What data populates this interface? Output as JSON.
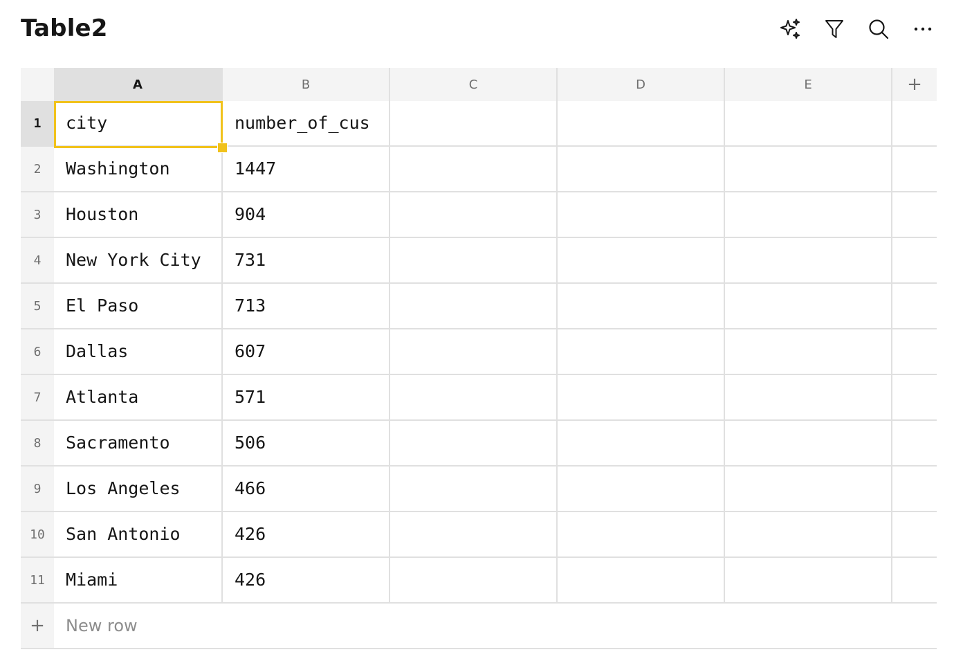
{
  "title": "Table2",
  "toolbar": {
    "icons": [
      "sparkle-icon",
      "filter-icon",
      "search-icon",
      "more-icon"
    ]
  },
  "columns": [
    "A",
    "B",
    "C",
    "D",
    "E"
  ],
  "add_column_label": "+",
  "selected": {
    "row": 1,
    "column": "A"
  },
  "rows": [
    {
      "num": "1",
      "cells": [
        "city",
        "number_of_cus",
        "",
        "",
        ""
      ]
    },
    {
      "num": "2",
      "cells": [
        "Washington",
        "1447",
        "",
        "",
        ""
      ]
    },
    {
      "num": "3",
      "cells": [
        "Houston",
        "904",
        "",
        "",
        ""
      ]
    },
    {
      "num": "4",
      "cells": [
        "New York City",
        "731",
        "",
        "",
        ""
      ]
    },
    {
      "num": "5",
      "cells": [
        "El Paso",
        "713",
        "",
        "",
        ""
      ]
    },
    {
      "num": "6",
      "cells": [
        "Dallas",
        "607",
        "",
        "",
        ""
      ]
    },
    {
      "num": "7",
      "cells": [
        "Atlanta",
        "571",
        "",
        "",
        ""
      ]
    },
    {
      "num": "8",
      "cells": [
        "Sacramento",
        "506",
        "",
        "",
        ""
      ]
    },
    {
      "num": "9",
      "cells": [
        "Los Angeles",
        "466",
        "",
        "",
        ""
      ]
    },
    {
      "num": "10",
      "cells": [
        "San Antonio",
        "426",
        "",
        "",
        ""
      ]
    },
    {
      "num": "11",
      "cells": [
        "Miami",
        "426",
        "",
        "",
        ""
      ]
    }
  ],
  "new_row": {
    "icon": "+",
    "label": "New row"
  }
}
